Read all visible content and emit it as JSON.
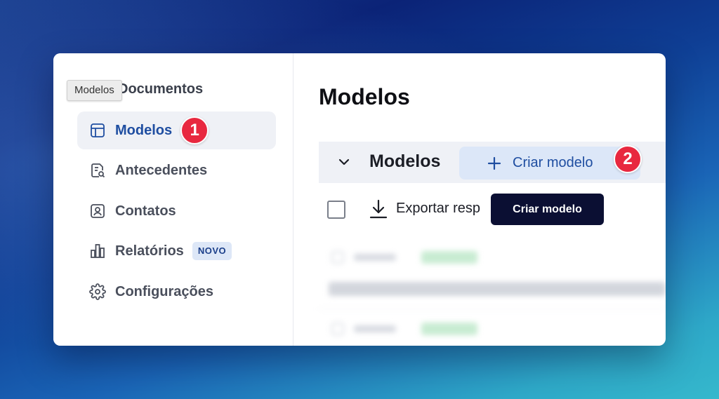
{
  "sidebar": {
    "section_title": "Documentos",
    "hover_tooltip": "Modelos",
    "items": [
      {
        "label": "Modelos",
        "icon": "template-icon",
        "active": true,
        "step": "1"
      },
      {
        "label": "Antecedentes",
        "icon": "document-search-icon"
      },
      {
        "label": "Contatos",
        "icon": "contact-card-icon"
      },
      {
        "label": "Relatórios",
        "icon": "bar-chart-icon",
        "badge": "NOVO"
      },
      {
        "label": "Configurações",
        "icon": "gear-icon"
      }
    ]
  },
  "main": {
    "page_title": "Modelos",
    "group": {
      "title": "Modelos",
      "create_button_label": "Criar modelo",
      "step": "2"
    },
    "actions": {
      "export_label": "Exportar resp"
    },
    "tooltip": "Criar modelo"
  },
  "colors": {
    "accent": "#1f4ea1",
    "step_badge": "#e8283f",
    "tooltip_bg": "#0b0f33",
    "active_bg": "#eff1f6"
  }
}
